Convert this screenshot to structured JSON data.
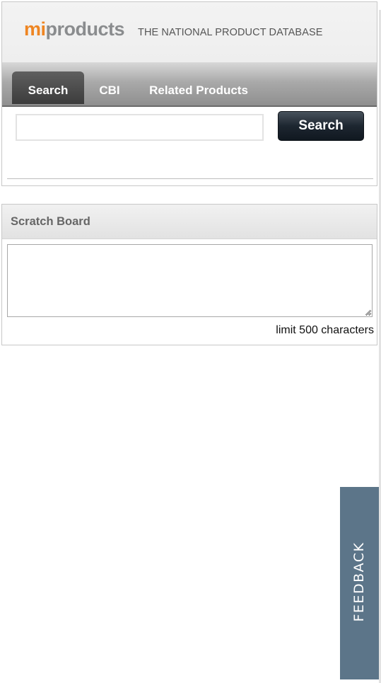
{
  "header": {
    "logo_mi": "mi",
    "logo_products": "products",
    "tagline": "THE NATIONAL PRODUCT DATABASE",
    "brand_colors": {
      "mi": "#ee8522",
      "products": "#8a8c8e"
    }
  },
  "tabs": [
    {
      "label": "Search",
      "active": true
    },
    {
      "label": "CBI",
      "active": false
    },
    {
      "label": "Related Products",
      "active": false
    }
  ],
  "search": {
    "value": "",
    "placeholder": "",
    "button_label": "Search"
  },
  "scratch_board": {
    "title": "Scratch Board",
    "value": "",
    "limit_note": "limit 500 characters"
  },
  "feedback": {
    "label": "FEEDBACK",
    "color": "#5c7589"
  }
}
